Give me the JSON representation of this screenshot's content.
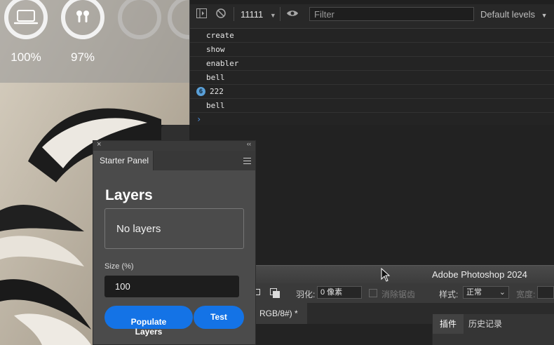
{
  "battery_widget": {
    "devices": [
      {
        "name": "laptop",
        "icon": "laptop-icon",
        "percent": "100%"
      },
      {
        "name": "earbuds",
        "icon": "earbuds-icon",
        "percent": "97%"
      }
    ]
  },
  "devtools": {
    "context": "11111",
    "filter_placeholder": "Filter",
    "levels": "Default levels",
    "logs": [
      {
        "text": "create"
      },
      {
        "text": "show"
      },
      {
        "text": "enabler"
      },
      {
        "text": "bell"
      },
      {
        "text": "222",
        "count": "6"
      },
      {
        "text": "bell"
      }
    ],
    "prompt": "›"
  },
  "photoshop": {
    "title": "Adobe Photoshop 2024",
    "options": {
      "feather_label": "羽化:",
      "feather_value": "0 像素",
      "antialias_label": "消除锯齿",
      "style_label": "样式:",
      "style_value": "正常",
      "width_label": "宽度:"
    },
    "doc_tab": "RGB/8#) *",
    "panel_tabs": [
      "插件",
      "历史记录"
    ]
  },
  "starter_panel": {
    "close": "×",
    "collapse": "‹‹",
    "tab": "Starter Panel",
    "heading": "Layers",
    "layers_text": "No layers",
    "size_label": "Size (%)",
    "size_value": "100",
    "populate_button": "Populate Layers",
    "test_button": "Test"
  },
  "colors": {
    "accent_blue": "#1473e6",
    "panel_bg": "#4b4b4b",
    "console_bg": "#242424"
  }
}
